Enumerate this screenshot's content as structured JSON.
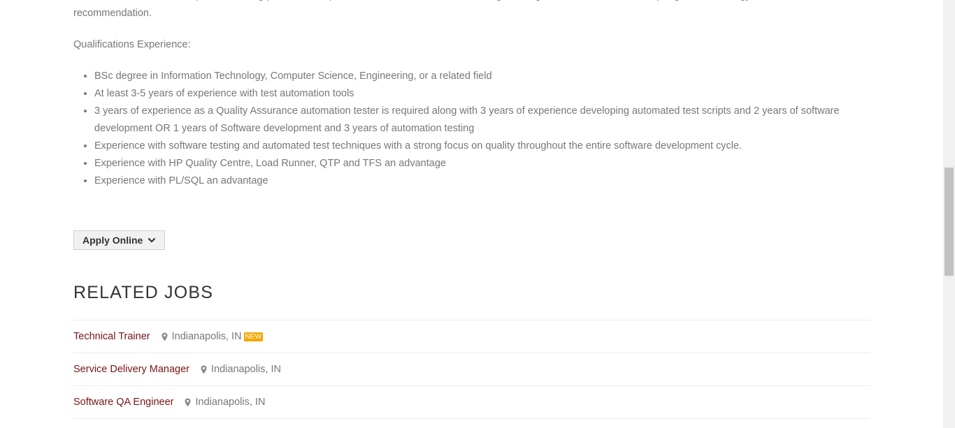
{
  "description": {
    "intro": "This individual has to be capable in driving processes, implement automation framework, change management with Business, adapt Agile methodology and automation tool recommendation.",
    "qualifications_heading": "Qualifications Experience:",
    "qualifications": [
      "BSc degree in Information Technology, Computer Science, Engineering, or a related field",
      "At least 3-5 years of experience with test automation tools",
      "3 years of experience as a Quality Assurance automation tester is required along with 3 years of experience developing automated test scripts and 2 years of software development OR 1 years of Software development and 3 years of automation testing",
      "Experience with software testing and automated test techniques with a strong focus on quality throughout the entire software development cycle.",
      "Experience with HP Quality Centre, Load Runner, QTP and TFS an advantage",
      "Experience with PL/SQL an advantage"
    ]
  },
  "apply": {
    "label": "Apply Online",
    "icon": "chevron-down-icon"
  },
  "related_jobs": {
    "heading": "RELATED JOBS",
    "location_icon": "map-pin-icon",
    "items": [
      {
        "title": "Technical Trainer",
        "location": "Indianapolis, IN",
        "badge": "NEW"
      },
      {
        "title": "Service Delivery Manager",
        "location": "Indianapolis, IN",
        "badge": ""
      },
      {
        "title": "Software QA Engineer",
        "location": "Indianapolis, IN",
        "badge": ""
      }
    ]
  },
  "colors": {
    "job_link": "#7a1414",
    "badge": "#f0a800",
    "text": "#777777",
    "heading": "#333333"
  }
}
